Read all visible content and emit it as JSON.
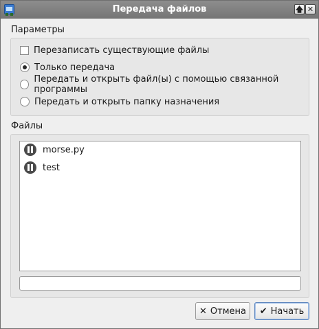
{
  "window": {
    "title": "Передача файлов"
  },
  "params": {
    "group_label": "Параметры",
    "overwrite_label": "Перезаписать существующие файлы",
    "overwrite_checked": false,
    "options": [
      {
        "label": "Только передача",
        "checked": true
      },
      {
        "label": "Передать и открыть файл(ы) с помощью связанной программы",
        "checked": false
      },
      {
        "label": "Передать и открыть папку назначения",
        "checked": false
      }
    ]
  },
  "files": {
    "group_label": "Файлы",
    "items": [
      {
        "name": "morse.py",
        "status_icon": "pause-icon"
      },
      {
        "name": "test",
        "status_icon": "pause-icon"
      }
    ],
    "progress_fraction": 0
  },
  "buttons": {
    "cancel_label": "Отмена",
    "cancel_icon": "close-icon",
    "start_label": "Начать",
    "start_icon": "checkmark-icon"
  },
  "colors": {
    "titlebar": "#808080",
    "primary_border": "#5a84bd"
  }
}
